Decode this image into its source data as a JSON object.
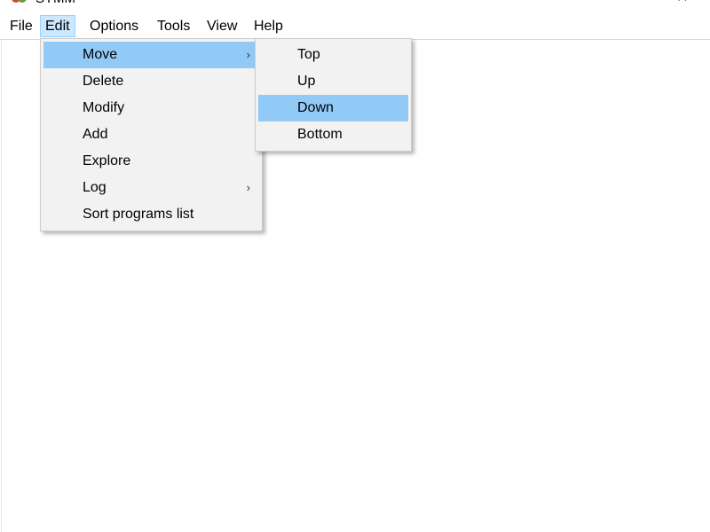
{
  "window": {
    "title": "SYMM",
    "minimize_glyph": "—",
    "close_glyph": "✕",
    "icon": "app-icon"
  },
  "menubar": {
    "items": [
      "File",
      "Edit",
      "Options",
      "Tools",
      "View",
      "Help"
    ],
    "active": "Edit"
  },
  "edit_menu": {
    "items": [
      {
        "label": "Move",
        "submenu": true,
        "highlighted": true
      },
      {
        "label": "Delete"
      },
      {
        "label": "Modify"
      },
      {
        "label": "Add"
      },
      {
        "label": "Explore"
      },
      {
        "label": "Log",
        "submenu": true
      },
      {
        "label": "Sort programs list"
      }
    ],
    "submenu_arrow": "›"
  },
  "move_submenu": {
    "items": [
      {
        "label": "Top"
      },
      {
        "label": "Up"
      },
      {
        "label": "Down",
        "highlighted": true
      },
      {
        "label": "Bottom"
      }
    ]
  },
  "colors": {
    "highlight": "#91c9f7",
    "menu_background": "#f2f2f2",
    "active_top_menu": "#cce8ff"
  }
}
